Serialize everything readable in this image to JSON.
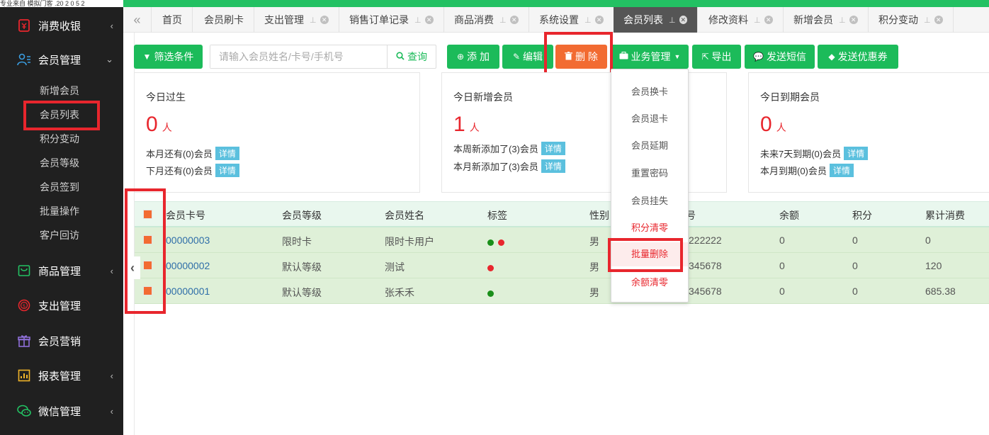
{
  "top_strip_text": "专业来自 模拟门客 .20 2 0 5 2",
  "colors": {
    "accent_green": "#1cbb5a",
    "delete_orange": "#f26b32",
    "highlight_red": "#e8262d",
    "sidebar_bg": "#202020"
  },
  "sidebar": {
    "groups": [
      {
        "label": "消费收银",
        "icon": "cashier-icon",
        "arrow": "‹"
      },
      {
        "label": "会员管理",
        "icon": "member-icon",
        "arrow": "⌄"
      },
      {
        "label": "商品管理",
        "icon": "goods-icon",
        "arrow": "‹"
      },
      {
        "label": "支出管理",
        "icon": "expense-icon",
        "arrow": ""
      },
      {
        "label": "会员营销",
        "icon": "gift-icon",
        "arrow": ""
      },
      {
        "label": "报表管理",
        "icon": "report-icon",
        "arrow": "‹"
      },
      {
        "label": "微信管理",
        "icon": "wechat-icon",
        "arrow": "‹"
      }
    ],
    "member_items": [
      "新增会员",
      "会员列表",
      "积分变动",
      "会员等级",
      "会员签到",
      "批量操作",
      "客户回访"
    ]
  },
  "tabs": [
    {
      "label": "首页"
    },
    {
      "label": "会员刷卡"
    },
    {
      "label": "支出管理"
    },
    {
      "label": "销售订单记录"
    },
    {
      "label": "商品消费"
    },
    {
      "label": "系统设置"
    },
    {
      "label": "会员列表"
    },
    {
      "label": "修改资料"
    },
    {
      "label": "新增会员"
    },
    {
      "label": "积分变动"
    }
  ],
  "toolbar": {
    "filter_label": "筛选条件",
    "search_placeholder": "请输入会员姓名/卡号/手机号",
    "search_button": "查询",
    "add_label": "添 加",
    "edit_label": "编辑",
    "delete_label": "删 除",
    "business_label": "业务管理",
    "export_label": "导出",
    "sms_label": "发送短信",
    "coupon_label": "发送优惠券"
  },
  "cards": {
    "birthday": {
      "title": "今日过生",
      "count": "0",
      "unit": "人",
      "line1": "本月还有(0)会员",
      "line2": "下月还有(0)会员",
      "detail": "详情"
    },
    "new_members": {
      "title": "今日新增会员",
      "count": "1",
      "unit": "人",
      "line1": "本周新添加了(3)会员",
      "line2": "本月新添加了(3)会员",
      "detail": "详情"
    },
    "expiring": {
      "title": "今日到期会员",
      "count": "0",
      "unit": "人",
      "line1": "未来7天到期(0)会员",
      "line2": "本月到期(0)会员",
      "detail": "详情"
    }
  },
  "table": {
    "headers": [
      "会员卡号",
      "会员等级",
      "会员姓名",
      "标签",
      "性别",
      "号",
      "余额",
      "积分",
      "累计消费"
    ],
    "rows": [
      {
        "card": "00000003",
        "level": "限时卡",
        "name": "限时卡用户",
        "tags": [
          "#1a8f1a",
          "#e8262d"
        ],
        "gender": "男",
        "phone": "222222",
        "balance": "0",
        "points": "0",
        "total": "0"
      },
      {
        "card": "00000002",
        "level": "默认等级",
        "name": "测试",
        "tags": [
          "#e8262d"
        ],
        "gender": "男",
        "phone": "345678",
        "balance": "0",
        "points": "0",
        "total": "120"
      },
      {
        "card": "00000001",
        "level": "默认等级",
        "name": "张禾禾",
        "tags": [
          "#1a8f1a"
        ],
        "gender": "男",
        "phone": "345678",
        "balance": "0",
        "points": "0",
        "total": "685.38"
      }
    ]
  },
  "dropdown": {
    "items": [
      {
        "label": "会员换卡",
        "style": "normal"
      },
      {
        "label": "会员退卡",
        "style": "normal"
      },
      {
        "label": "会员延期",
        "style": "normal"
      },
      {
        "label": "重置密码",
        "style": "normal"
      },
      {
        "label": "会员挂失",
        "style": "normal"
      },
      {
        "label": "积分清零",
        "style": "red"
      },
      {
        "label": "批量删除",
        "style": "red-highlight"
      },
      {
        "label": "余额清零",
        "style": "red"
      }
    ]
  }
}
